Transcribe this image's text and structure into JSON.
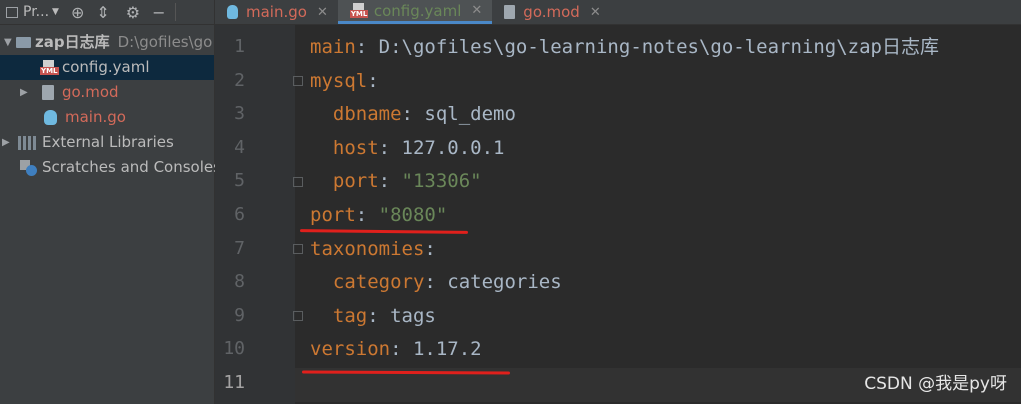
{
  "project_panel": {
    "title": "Pr...",
    "root": {
      "name": "zap日志库",
      "path": "D:\\gofiles\\go"
    },
    "files": [
      {
        "label": "config.yaml",
        "icon": "yaml-file-icon"
      },
      {
        "label": "go.mod",
        "icon": "go-mod-file-icon"
      },
      {
        "label": "main.go",
        "icon": "go-file-icon"
      }
    ],
    "external_libraries": "External Libraries",
    "scratches": "Scratches and Consoles"
  },
  "tabs": [
    {
      "label": "main.go",
      "icon": "go-file-icon"
    },
    {
      "label": "config.yaml",
      "icon": "yaml-file-icon",
      "active": true
    },
    {
      "label": "go.mod",
      "icon": "go-mod-file-icon"
    }
  ],
  "editor": {
    "line_numbers": [
      "1",
      "2",
      "3",
      "4",
      "5",
      "6",
      "7",
      "8",
      "9",
      "10",
      "11"
    ],
    "current_line": "11",
    "lines": [
      {
        "key": "main",
        "sep": ": ",
        "value": "D:\\gofiles\\go-learning-notes\\go-learning\\zap日志库"
      },
      {
        "key": "mysql",
        "sep": ":",
        "value": ""
      },
      {
        "indent": "  ",
        "key": "dbname",
        "sep": ": ",
        "value": "sql_demo"
      },
      {
        "indent": "  ",
        "key": "host",
        "sep": ": ",
        "value": "127.0.0.1"
      },
      {
        "indent": "  ",
        "key": "port",
        "sep": ": ",
        "string": "\"13306\""
      },
      {
        "key": "port",
        "sep": ": ",
        "string": "\"8080\""
      },
      {
        "key": "taxonomies",
        "sep": ":",
        "value": ""
      },
      {
        "indent": "  ",
        "key": "category",
        "sep": ": ",
        "value": "categories"
      },
      {
        "indent": "  ",
        "key": "tag",
        "sep": ": ",
        "value": "tags"
      },
      {
        "key": "version",
        "sep": ": ",
        "value": "1.17.2"
      }
    ]
  },
  "watermark": "CSDN @我是py呀",
  "colors": {
    "key": "#cc7832",
    "string": "#6a8759",
    "text": "#a9b7c6",
    "annotation": "#e0201c",
    "selection": "#0d293e"
  }
}
